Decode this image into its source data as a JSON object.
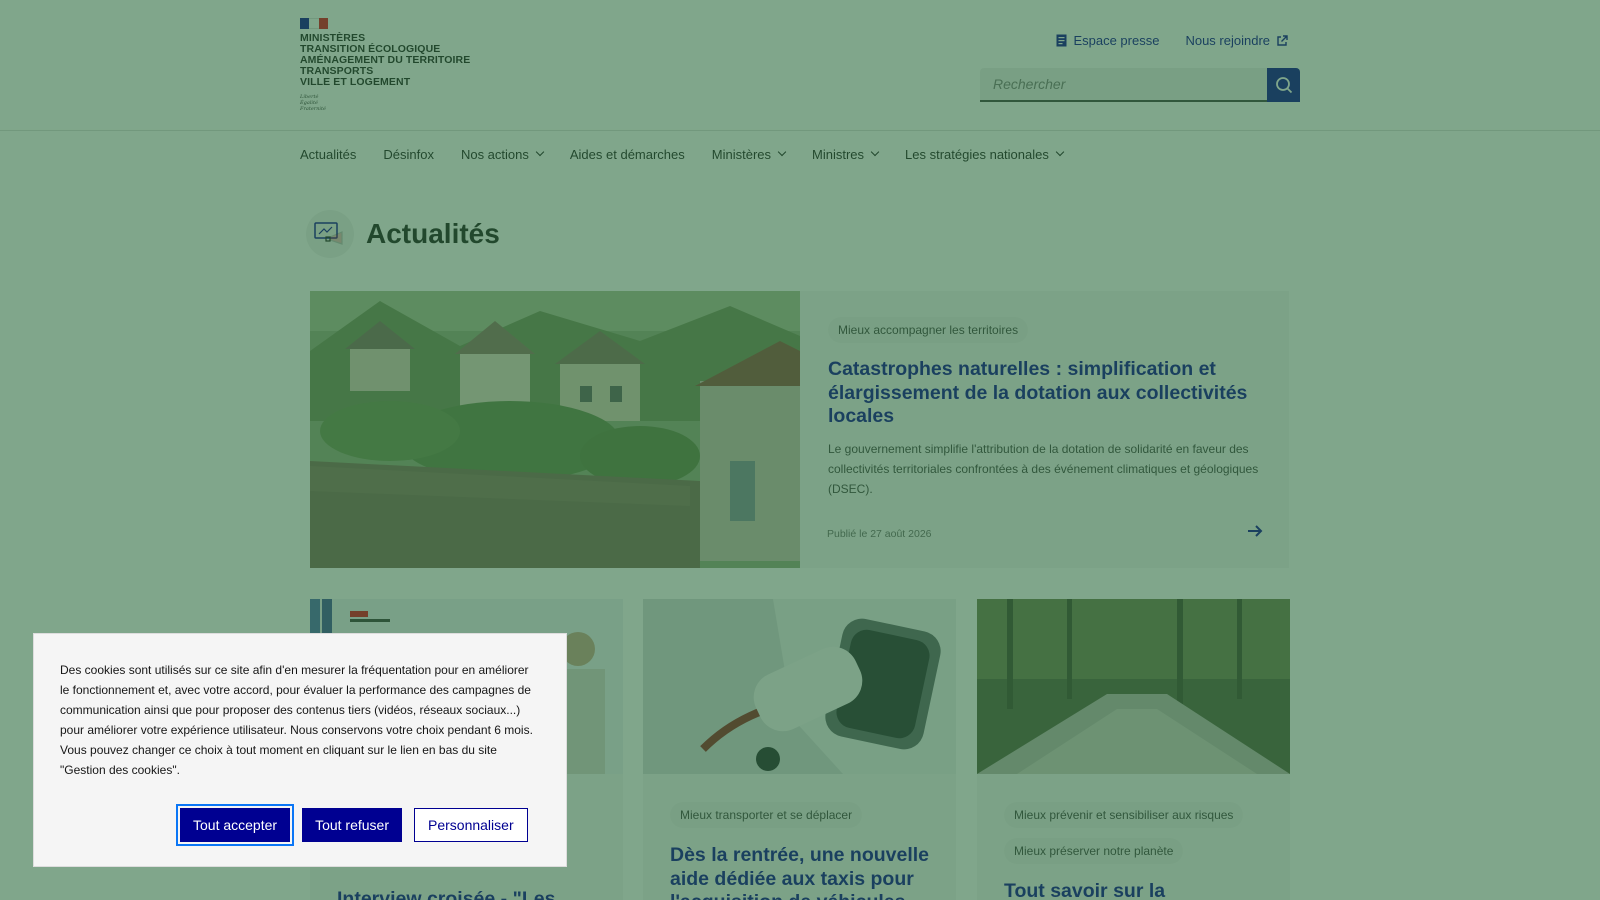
{
  "header": {
    "logo_lines": [
      "MINISTÈRES",
      "TRANSITION ÉCOLOGIQUE",
      "AMÉNAGEMENT DU TERRITOIRE",
      "TRANSPORTS",
      "VILLE ET LOGEMENT"
    ],
    "motto": [
      "Liberté",
      "Égalité",
      "Fraternité"
    ],
    "tools": {
      "press_label": "Espace presse",
      "join_label": "Nous rejoindre"
    },
    "search": {
      "placeholder": "Rechercher"
    }
  },
  "nav": {
    "items": [
      {
        "label": "Actualités",
        "has_menu": false
      },
      {
        "label": "Désinfox",
        "has_menu": false
      },
      {
        "label": "Nos actions",
        "has_menu": true
      },
      {
        "label": "Aides et démarches",
        "has_menu": false
      },
      {
        "label": "Ministères",
        "has_menu": true
      },
      {
        "label": "Ministres",
        "has_menu": true
      },
      {
        "label": "Les stratégies nationales",
        "has_menu": true
      }
    ]
  },
  "page": {
    "title": "Actualités",
    "icon": "megaphone-icon"
  },
  "hero": {
    "tag": "Mieux accompagner les territoires",
    "title": "Catastrophes naturelles : simplification et élargissement de la dotation aux collectivités locales",
    "description": "Le gouvernement simplifie l'attribution de la dotation de solidarité en faveur des collectivités territoriales confrontées à des événement climatiques et géologiques (DSEC).",
    "date": "Publié le 27 août 2026"
  },
  "cards": [
    {
      "tags": [],
      "title": "Interview croisée - \"Les"
    },
    {
      "tags": [
        "Mieux transporter et se déplacer"
      ],
      "title": "Dès la rentrée, une nouvelle aide dédiée aux taxis pour l'acquisition de véhicules"
    },
    {
      "tags": [
        "Mieux prévenir et sensibiliser aux risques",
        "Mieux préserver notre planète"
      ],
      "title": "Tout savoir sur la sécheresse"
    }
  ],
  "cookie": {
    "text": "Des cookies sont utilisés sur ce site afin d'en mesurer la fréquentation pour en améliorer le fonctionnement et, avec votre accord, pour évaluer la performance des campagnes de communication ainsi que pour proposer des contenus tiers (vidéos, réseaux sociaux...) pour améliorer votre expérience utilisateur. Nous conservons votre choix pendant 6 mois. Vous pouvez changer ce choix à tout moment en cliquant sur le lien en bas du site \"Gestion des cookies\".",
    "accept_label": "Tout accepter",
    "refuse_label": "Tout refuser",
    "customize_label": "Personnaliser"
  },
  "colors": {
    "brand_blue": "#000091",
    "overlay": "#2c6b3e",
    "flag_blue": "#000091",
    "flag_red": "#e1000f"
  }
}
